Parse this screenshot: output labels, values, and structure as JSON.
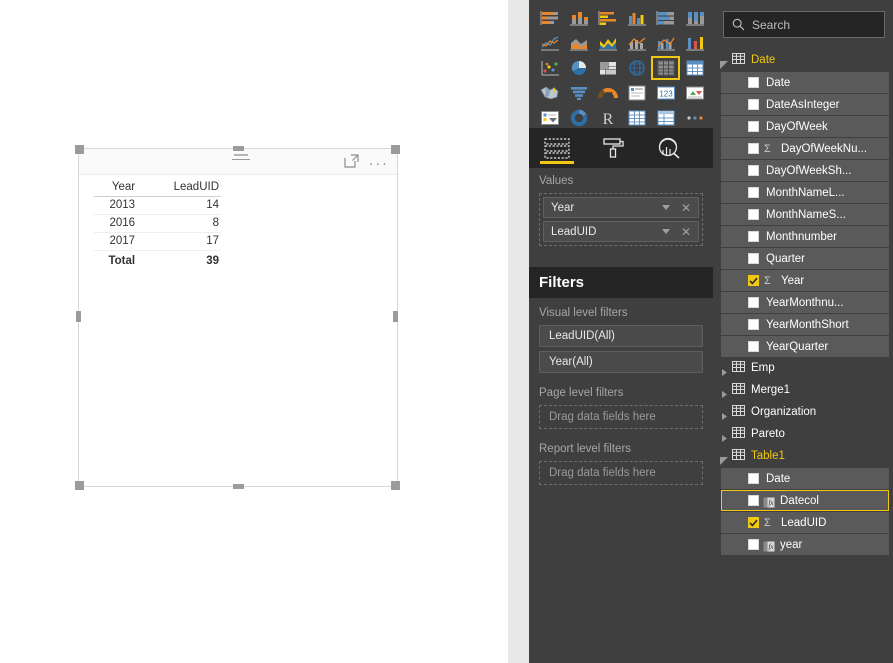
{
  "canvas": {
    "visual": {
      "header": {
        "filter_icon": "hamburger-filter-icon",
        "focus_icon": "focus-mode-icon",
        "more_label": "..."
      },
      "table": {
        "columns": [
          "Year",
          "LeadUID"
        ],
        "rows": [
          [
            "2013",
            "14"
          ],
          [
            "2016",
            "8"
          ],
          [
            "2017",
            "17"
          ]
        ],
        "total_label": "Total",
        "total_value": "39"
      }
    }
  },
  "visualizations": {
    "gallery": [
      [
        "stacked-bar-chart",
        "stacked-column-chart",
        "clustered-bar-chart",
        "clustered-column-chart",
        "100-stacked-bar-chart",
        "100-stacked-column-chart"
      ],
      [
        "line-chart",
        "area-chart",
        "stacked-area-chart",
        "line-and-stacked-column-chart",
        "line-and-clustered-column-chart",
        "ribbon-chart"
      ],
      [
        "scatter-chart",
        "pie-chart",
        "treemap",
        "map",
        "table",
        "matrix"
      ],
      [
        "filled-map",
        "funnel-chart",
        "gauge-chart",
        "multi-row-card",
        "card",
        "kpi"
      ],
      [
        "slicer",
        "donut-chart",
        "r-script-visual",
        "table-alt",
        "matrix-alt",
        "more-visuals"
      ]
    ],
    "selected": "table",
    "tabs": [
      {
        "name": "fields-tab",
        "icon": "fields-icon",
        "active": true
      },
      {
        "name": "format-tab",
        "icon": "paint-roller-icon",
        "active": false
      },
      {
        "name": "analytics-tab",
        "icon": "analytics-magnifier-icon",
        "active": false
      }
    ],
    "values": {
      "label": "Values",
      "items": [
        {
          "label": "Year"
        },
        {
          "label": "LeadUID"
        }
      ]
    }
  },
  "filters": {
    "title": "Filters",
    "groups": [
      {
        "label": "Visual level filters",
        "cards": [
          "LeadUID(All)",
          "Year(All)"
        ],
        "placeholder": null
      },
      {
        "label": "Page level filters",
        "cards": [],
        "placeholder": "Drag data fields here"
      },
      {
        "label": "Report level filters",
        "cards": [],
        "placeholder": "Drag data fields here"
      }
    ]
  },
  "fields": {
    "search": {
      "placeholder": "Search",
      "icon": "search-icon"
    },
    "tables": [
      {
        "name": "Date",
        "expanded": true,
        "fields": [
          {
            "label": "Date",
            "checked": false,
            "sigma": false,
            "fx": false,
            "selected": false
          },
          {
            "label": "DateAsInteger",
            "checked": false,
            "sigma": false,
            "fx": false,
            "selected": false
          },
          {
            "label": "DayOfWeek",
            "checked": false,
            "sigma": false,
            "fx": false,
            "selected": false
          },
          {
            "label": "DayOfWeekNu...",
            "checked": false,
            "sigma": true,
            "fx": false,
            "selected": false
          },
          {
            "label": "DayOfWeekSh...",
            "checked": false,
            "sigma": false,
            "fx": false,
            "selected": false
          },
          {
            "label": "MonthNameL...",
            "checked": false,
            "sigma": false,
            "fx": false,
            "selected": false
          },
          {
            "label": "MonthNameS...",
            "checked": false,
            "sigma": false,
            "fx": false,
            "selected": false
          },
          {
            "label": "Monthnumber",
            "checked": false,
            "sigma": false,
            "fx": false,
            "selected": false
          },
          {
            "label": "Quarter",
            "checked": false,
            "sigma": false,
            "fx": false,
            "selected": false
          },
          {
            "label": "Year",
            "checked": true,
            "sigma": true,
            "fx": false,
            "selected": false
          },
          {
            "label": "YearMonthnu...",
            "checked": false,
            "sigma": false,
            "fx": false,
            "selected": false
          },
          {
            "label": "YearMonthShort",
            "checked": false,
            "sigma": false,
            "fx": false,
            "selected": false
          },
          {
            "label": "YearQuarter",
            "checked": false,
            "sigma": false,
            "fx": false,
            "selected": false
          }
        ]
      },
      {
        "name": "Emp",
        "expanded": false,
        "fields": []
      },
      {
        "name": "Merge1",
        "expanded": false,
        "fields": []
      },
      {
        "name": "Organization",
        "expanded": false,
        "fields": []
      },
      {
        "name": "Pareto",
        "expanded": false,
        "fields": []
      },
      {
        "name": "Table1",
        "expanded": true,
        "fields": [
          {
            "label": "Date",
            "checked": false,
            "sigma": false,
            "fx": false,
            "selected": false
          },
          {
            "label": "Datecol",
            "checked": false,
            "sigma": false,
            "fx": true,
            "selected": true
          },
          {
            "label": "LeadUID",
            "checked": true,
            "sigma": true,
            "fx": false,
            "selected": false
          },
          {
            "label": "year",
            "checked": false,
            "sigma": false,
            "fx": true,
            "selected": false
          }
        ]
      }
    ]
  },
  "colors": {
    "accent": "#f2c811",
    "pane_bg": "#3f3f3f",
    "pane_dark": "#252525",
    "field_row": "#5a5a5a",
    "canvas_bg": "#e8e8e8"
  }
}
